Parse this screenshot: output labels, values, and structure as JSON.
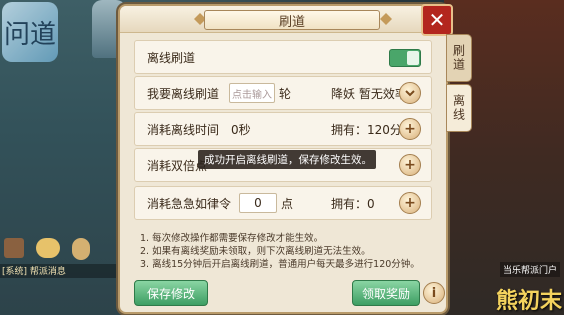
{
  "dialog": {
    "title": "刷道",
    "rows": {
      "offline": {
        "label": "离线刷道",
        "toggle_on": true
      },
      "want": {
        "label": "我要离线刷道",
        "placeholder": "点击输入",
        "unit": "轮",
        "status": "降妖 暂无效率"
      },
      "time": {
        "label": "消耗离线时间",
        "value": "0秒",
        "own": "拥有：120分"
      },
      "double": {
        "label": "消耗双倍点"
      },
      "jiji": {
        "label": "消耗急急如律令",
        "value": "0",
        "unit": "点",
        "own": "拥有：0"
      }
    },
    "tooltip": "成功开启离线刷道，保存修改生效。",
    "notes": [
      "1. 每次修改操作都需要保存修改才能生效。",
      "2. 如果有离线奖励未领取，则下次离线刷道无法生效。",
      "3. 离线15分钟后开启离线刷道，普通用户每天最多进行120分钟。"
    ],
    "save_label": "保存修改",
    "claim_label": "领取奖励"
  },
  "tabs": [
    "刷道",
    "离线"
  ],
  "watermark": "熊初末",
  "sign_text": "当乐帮派门户",
  "chat_line": "[系统] 帮派消息",
  "logo_text": "问道"
}
